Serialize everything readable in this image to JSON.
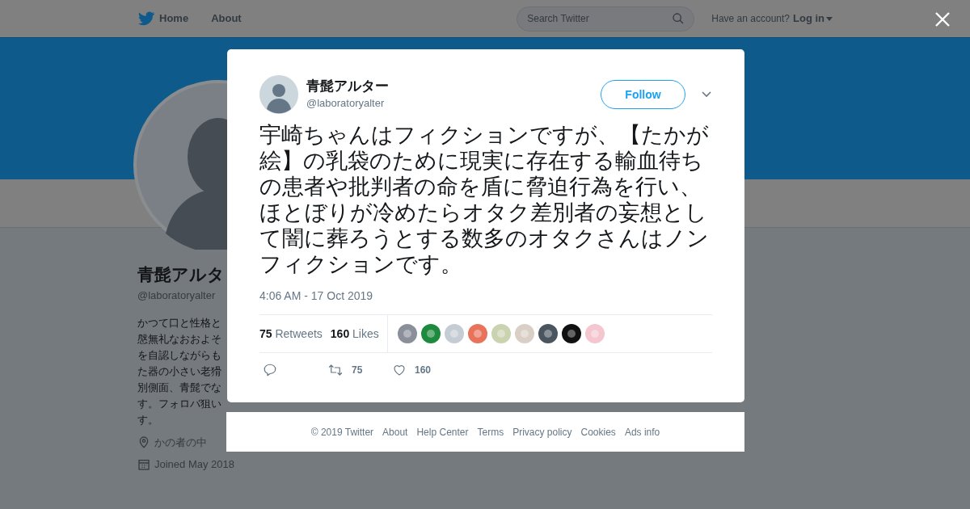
{
  "nav": {
    "items": [
      {
        "label": "Home"
      },
      {
        "label": "About"
      }
    ],
    "search": {
      "placeholder": "Search Twitter"
    },
    "account_prompt": "Have an account?",
    "login": "Log in"
  },
  "profile": {
    "name": "青髭アルタ",
    "handle": "@laboratoryalter",
    "bio_lines": [
      "かつて口と性格と",
      "慇無礼なおおよそ",
      "を自認しながらも",
      "た器の小さい老猾",
      "別側面、青髭でな",
      "す。フォロバ狙い",
      "す。"
    ],
    "location": "かの者の中",
    "joined": "Joined May 2018"
  },
  "tweet": {
    "name": "青髭アルター",
    "handle": "@laboratoryalter",
    "follow": "Follow",
    "text": "宇崎ちゃんはフィクションですが、【たかが絵】の乳袋のために現実に存在する輸血待ちの患者や批判者の命を盾に脅迫行為を行い、ほとぼりが冷めたらオタク差別者の妄想として闇に葬ろうとする数多のオタクさんはノンフィクションです。",
    "time": "4:06 AM - 17 Oct 2019",
    "stats": [
      {
        "count": "75",
        "label": "Retweets"
      },
      {
        "count": "160",
        "label": "Likes"
      }
    ],
    "likers": [
      {
        "color": "#8a8f9a"
      },
      {
        "color": "#1e8a3e"
      },
      {
        "color": "#c5ccd3"
      },
      {
        "color": "#e8735a"
      },
      {
        "color": "#c9d3b0"
      },
      {
        "color": "#d9cfc6"
      },
      {
        "color": "#4a5560"
      },
      {
        "color": "#111111"
      },
      {
        "color": "#f4c6cf"
      }
    ],
    "actions": [
      {
        "kind": "reply"
      },
      {
        "kind": "retweet",
        "count": "75"
      },
      {
        "kind": "like",
        "count": "160"
      }
    ]
  },
  "footer": [
    "© 2019 Twitter",
    "About",
    "Help Center",
    "Terms",
    "Privacy policy",
    "Cookies",
    "Ads info"
  ]
}
